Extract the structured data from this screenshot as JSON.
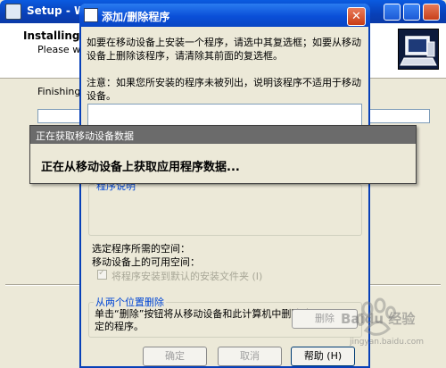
{
  "setup": {
    "title": "Setup - Wel",
    "heading": "Installing",
    "subheading": "Please w",
    "status": "Finishing",
    "next_label": ""
  },
  "dialog": {
    "title": "添加/删除程序",
    "close_label": "✕",
    "instruction": "如要在移动设备上安装一个程序，请选中其复选框；如要从移动设备上删除该程序，请清除其前面的复选框。",
    "note": "注意：如果您所安装的程序未被列出，说明该程序不适用于移动设备。",
    "description_label": "程序说明",
    "required_space_label": "选定程序所需的空间：",
    "available_space_label": "移动设备上的可用空间：",
    "default_folder_label": "将程序安装到默认的安装文件夹 (I)",
    "remove_group_label": "从两个位置删除",
    "remove_instruction": "单击“删除”按钮将从移动设备和此计算机中删除选定的程序。",
    "remove_label": "删除",
    "ok_label": "确定",
    "cancel_label": "取消",
    "help_label": "帮助 (H)"
  },
  "popup": {
    "title": "正在获取移动设备数据",
    "message": "正在从移动设备上获取应用程序数据..."
  },
  "watermark": {
    "text": "Baidu 经验",
    "url": "jingyan.baidu.com"
  },
  "icons": {
    "setup_logo": "computer-icon",
    "dialog_app": "app-icon",
    "watermark": "baidu-paw-icon"
  },
  "colors": {
    "titlebar_blue": "#0a4fd8",
    "popup_titlebar": "#6b6b6b",
    "group_label": "#0046d5"
  }
}
